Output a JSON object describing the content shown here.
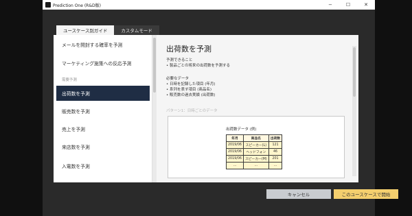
{
  "window": {
    "title": "Prediction One (R&D版)",
    "controls": {
      "minimize": "−",
      "maximize": "☐",
      "close": "✕"
    }
  },
  "tabs": [
    {
      "label": "ユースケース別ガイド",
      "active": true
    },
    {
      "label": "カスタムモード",
      "active": false
    }
  ],
  "sidebar": {
    "items": [
      {
        "label": "メールを開封する確率を予測"
      },
      {
        "label": "マーケティング施策への反応予測"
      }
    ],
    "group_label": "需要予測",
    "group_items": [
      {
        "label": "出荷数を予測",
        "active": true
      },
      {
        "label": "販売数を予測"
      },
      {
        "label": "売上を予測"
      },
      {
        "label": "来店数を予測"
      },
      {
        "label": "入電数を予測"
      }
    ]
  },
  "content": {
    "title": "出荷数を予測",
    "can_predict_heading": "予測できること",
    "can_predict_item": "製品ごとの将来の出荷数を予測する",
    "required_heading": "必要なデータ",
    "required_items": [
      "日時を記録した項目 (年月)",
      "系列を表す項目 (商品名)",
      "販売数の過去実績 (出荷数)"
    ],
    "pattern_label": "パターン1：日時ごとのデータ",
    "example": {
      "title": "出荷数データ (例)",
      "headers": [
        "年月",
        "商品名",
        "出荷数"
      ],
      "rows": [
        [
          "2019/06",
          "スピーカー(L)",
          "121"
        ],
        [
          "2019/06",
          "ヘッドフォン",
          "46"
        ],
        [
          "2019/06",
          "スピーカー(M)",
          "201"
        ],
        [
          "…",
          "…",
          "…"
        ]
      ]
    }
  },
  "buttons": {
    "cancel": "キャンセル",
    "start": "このユースケースで開始"
  }
}
